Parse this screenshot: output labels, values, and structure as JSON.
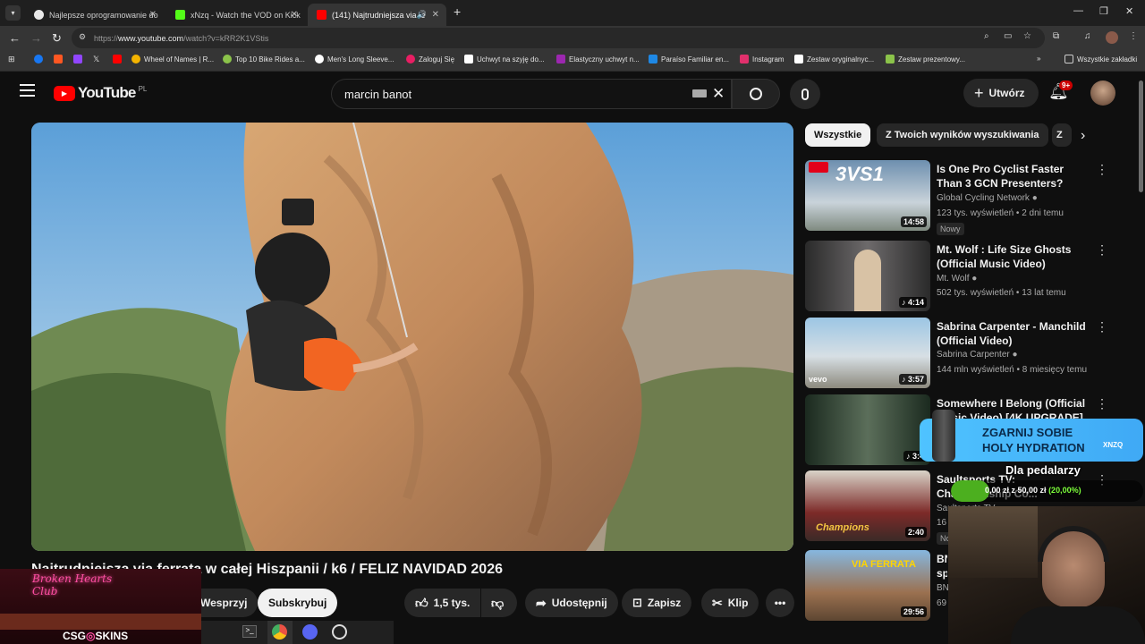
{
  "browser": {
    "tabs": [
      {
        "title": "Najlepsze oprogramowanie do",
        "color": "#e8e8e8",
        "active": false
      },
      {
        "title": "xNzq - Watch the VOD on Kick",
        "color": "#53fc18",
        "active": false
      },
      {
        "title": "(141) Najtrudniejsza via fer",
        "color": "#ff0000",
        "active": true
      }
    ],
    "url_prefix": "https://",
    "url_domain": "www.youtube.com",
    "url_path": "/watch?v=kRR2K1VStis",
    "bookmarks": [
      {
        "label": "Wheel of Names | R...",
        "color": "#f4b400"
      },
      {
        "label": "Top 10 Bike Rides a...",
        "color": "#8bc34a"
      },
      {
        "label": "Men's Long Sleeve...",
        "color": "#ffffff"
      },
      {
        "label": "Zaloguj Się",
        "color": "#e91e63"
      },
      {
        "label": "Uchwyt na szyję do...",
        "color": "#ffffff"
      },
      {
        "label": "Elastyczny uchwyt n...",
        "color": "#9c27b0"
      },
      {
        "label": "Paraíso Familiar en...",
        "color": "#1e88e5"
      },
      {
        "label": "Instagram",
        "color": "#e1306c"
      },
      {
        "label": "Zestaw oryginalnyc...",
        "color": "#ffffff"
      },
      {
        "label": "Zestaw prezentowy...",
        "color": "#8bc34a"
      }
    ],
    "all_bookmarks": "Wszystkie zakładki"
  },
  "youtube": {
    "logo_text": "YouTube",
    "logo_region": "PL",
    "search_value": "marcin banot",
    "create_label": "Utwórz",
    "notif_count": "9+",
    "chips": [
      "Wszystkie",
      "Z Twoich wyników wyszukiwania",
      "Z"
    ],
    "video_title": "Najtrudniejsza via ferrata w całej Hiszpanii / k6 / FELIZ NAVIDAD 2026",
    "actions": {
      "support": "Wesprzyj",
      "subscribe": "Subskrybuj",
      "likes": "1,5 tys.",
      "share": "Udostępnij",
      "save": "Zapisz",
      "clip": "Klip"
    },
    "recommendations": [
      {
        "title": "Is One Pro Cyclist Faster Than 3 GCN Presenters?",
        "channel": "Global Cycling Network",
        "meta": "123 tys. wyświetleń • 2 dni temu",
        "duration": "14:58",
        "badge": "Nowy",
        "thumb_overlay": "3VS1"
      },
      {
        "title": "Mt. Wolf : Life Size Ghosts (Official Music Video)",
        "channel": "Mt. Wolf",
        "meta": "502 tys. wyświetleń • 13 lat temu",
        "duration": "4:14"
      },
      {
        "title": "Sabrina Carpenter - Manchild (Official Video)",
        "channel": "Sabrina Carpenter",
        "meta": "144 mln wyświetleń • 8 miesięcy temu",
        "duration": "3:57",
        "thumb_overlay": "vevo"
      },
      {
        "title": "Somewhere I Belong (Official Music Video) [4K UPGRADE] –...",
        "channel": "",
        "meta": "",
        "duration": "3:4"
      },
      {
        "title": "Saultsports TV: Championship Co...",
        "channel": "Saultsports TV",
        "meta": "16",
        "duration": "2:40",
        "badge": "No",
        "thumb_overlay": "Champions"
      },
      {
        "title": "BN... sp...",
        "channel": "BN",
        "meta": "69",
        "duration": "29:56",
        "thumb_overlay": "VIA FERRATA"
      }
    ]
  },
  "overlays": {
    "promo_title_1": "ZGARNIJ SOBIE",
    "promo_title_2": "HOLY HYDRATION",
    "promo_brand": "XNZQ",
    "goal_label": "Dla pedalarzy",
    "goal_value": "0,00 zł z 50,00 zł",
    "goal_percent": "(20,00%)",
    "goal_progress": 0.2,
    "csg_brand": "CSG SKINS",
    "csg_sign": "Broken Hearts Club"
  }
}
